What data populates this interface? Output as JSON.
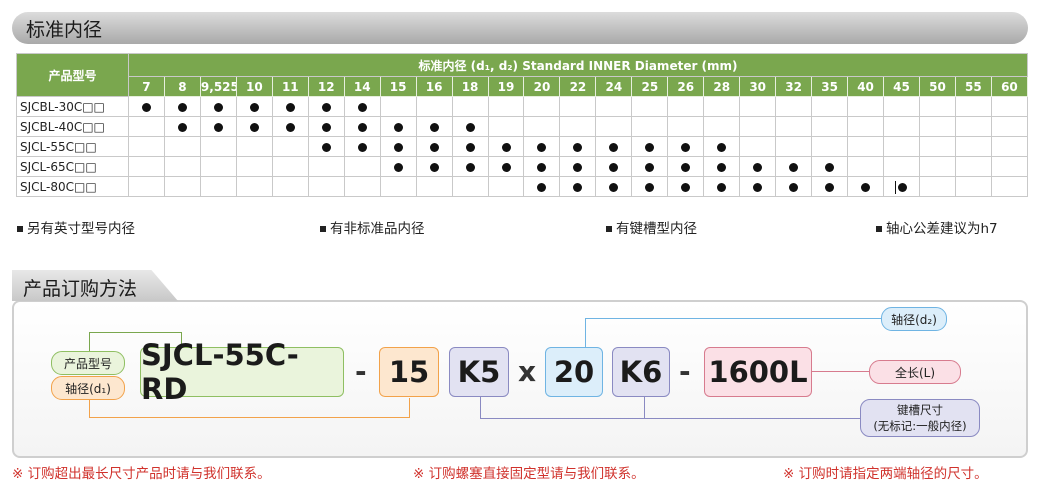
{
  "section1": {
    "title": "标准内径",
    "table_title": "标准内径 (d₁, d₂) Standard INNER Diameter (mm)",
    "model_header": "产品型号",
    "sizes": [
      "7",
      "8",
      "9,525",
      "10",
      "11",
      "12",
      "14",
      "15",
      "16",
      "18",
      "19",
      "20",
      "22",
      "24",
      "25",
      "26",
      "28",
      "30",
      "32",
      "35",
      "40",
      "45",
      "50",
      "55",
      "60"
    ],
    "rows": [
      {
        "model": "SJCBL-30C□□",
        "marks": [
          "7",
          "8",
          "9,525",
          "10",
          "11",
          "12",
          "14"
        ]
      },
      {
        "model": "SJCBL-40C□□",
        "marks": [
          "8",
          "9,525",
          "10",
          "11",
          "12",
          "14",
          "15",
          "16",
          "18"
        ]
      },
      {
        "model": "SJCL-55C□□",
        "marks": [
          "12",
          "14",
          "15",
          "16",
          "18",
          "19",
          "20",
          "22",
          "24",
          "25",
          "26",
          "28"
        ]
      },
      {
        "model": "SJCL-65C□□",
        "marks": [
          "15",
          "16",
          "18",
          "19",
          "20",
          "22",
          "24",
          "25",
          "26",
          "28",
          "30",
          "32",
          "35"
        ]
      },
      {
        "model": "SJCL-80C□□",
        "marks": [
          "20",
          "22",
          "24",
          "25",
          "26",
          "28",
          "30",
          "32",
          "35",
          "40",
          "45"
        ]
      }
    ],
    "bar_mark_size": "45",
    "notes": [
      "另有英寸型号内径",
      "有非标准品内径",
      "有键槽型内径",
      "轴心公差建议为h7"
    ]
  },
  "section2": {
    "title": "产品订购方法",
    "label_model": "产品型号",
    "label_shaft1": "轴径(d₁)",
    "label_shaft2": "轴径(d₂)",
    "label_length": "全长(L)",
    "label_key_line1": "键槽尺寸",
    "label_key_line2": "(无标记:一般内径)",
    "code": {
      "model": "SJCL-55C-RD",
      "dash1": "-",
      "d1": "15",
      "k1": "K5",
      "x": "x",
      "d2": "20",
      "k2": "K6",
      "dash2": "-",
      "length": "1600L"
    }
  },
  "footnotes": [
    "※ 订购超出最长尺寸产品时请与我们联系。",
    "※ 订购螺塞直接固定型请与我们联系。",
    "※ 订购时请指定两端轴径的尺寸。"
  ],
  "colors": {
    "table_green": "#7aa74e",
    "model_green_fill": "#eaf4dc",
    "model_green_border": "#8fbf62",
    "orange_fill": "#fde7cf",
    "orange_border": "#f2a24a",
    "blue_fill": "#dceefa",
    "blue_border": "#6fb4e3",
    "purple_fill": "#e2e2f2",
    "purple_border": "#8a8ac2",
    "pink_fill": "#fbe0e6",
    "pink_border": "#d77b8e",
    "footnote_red": "#d0322c"
  }
}
